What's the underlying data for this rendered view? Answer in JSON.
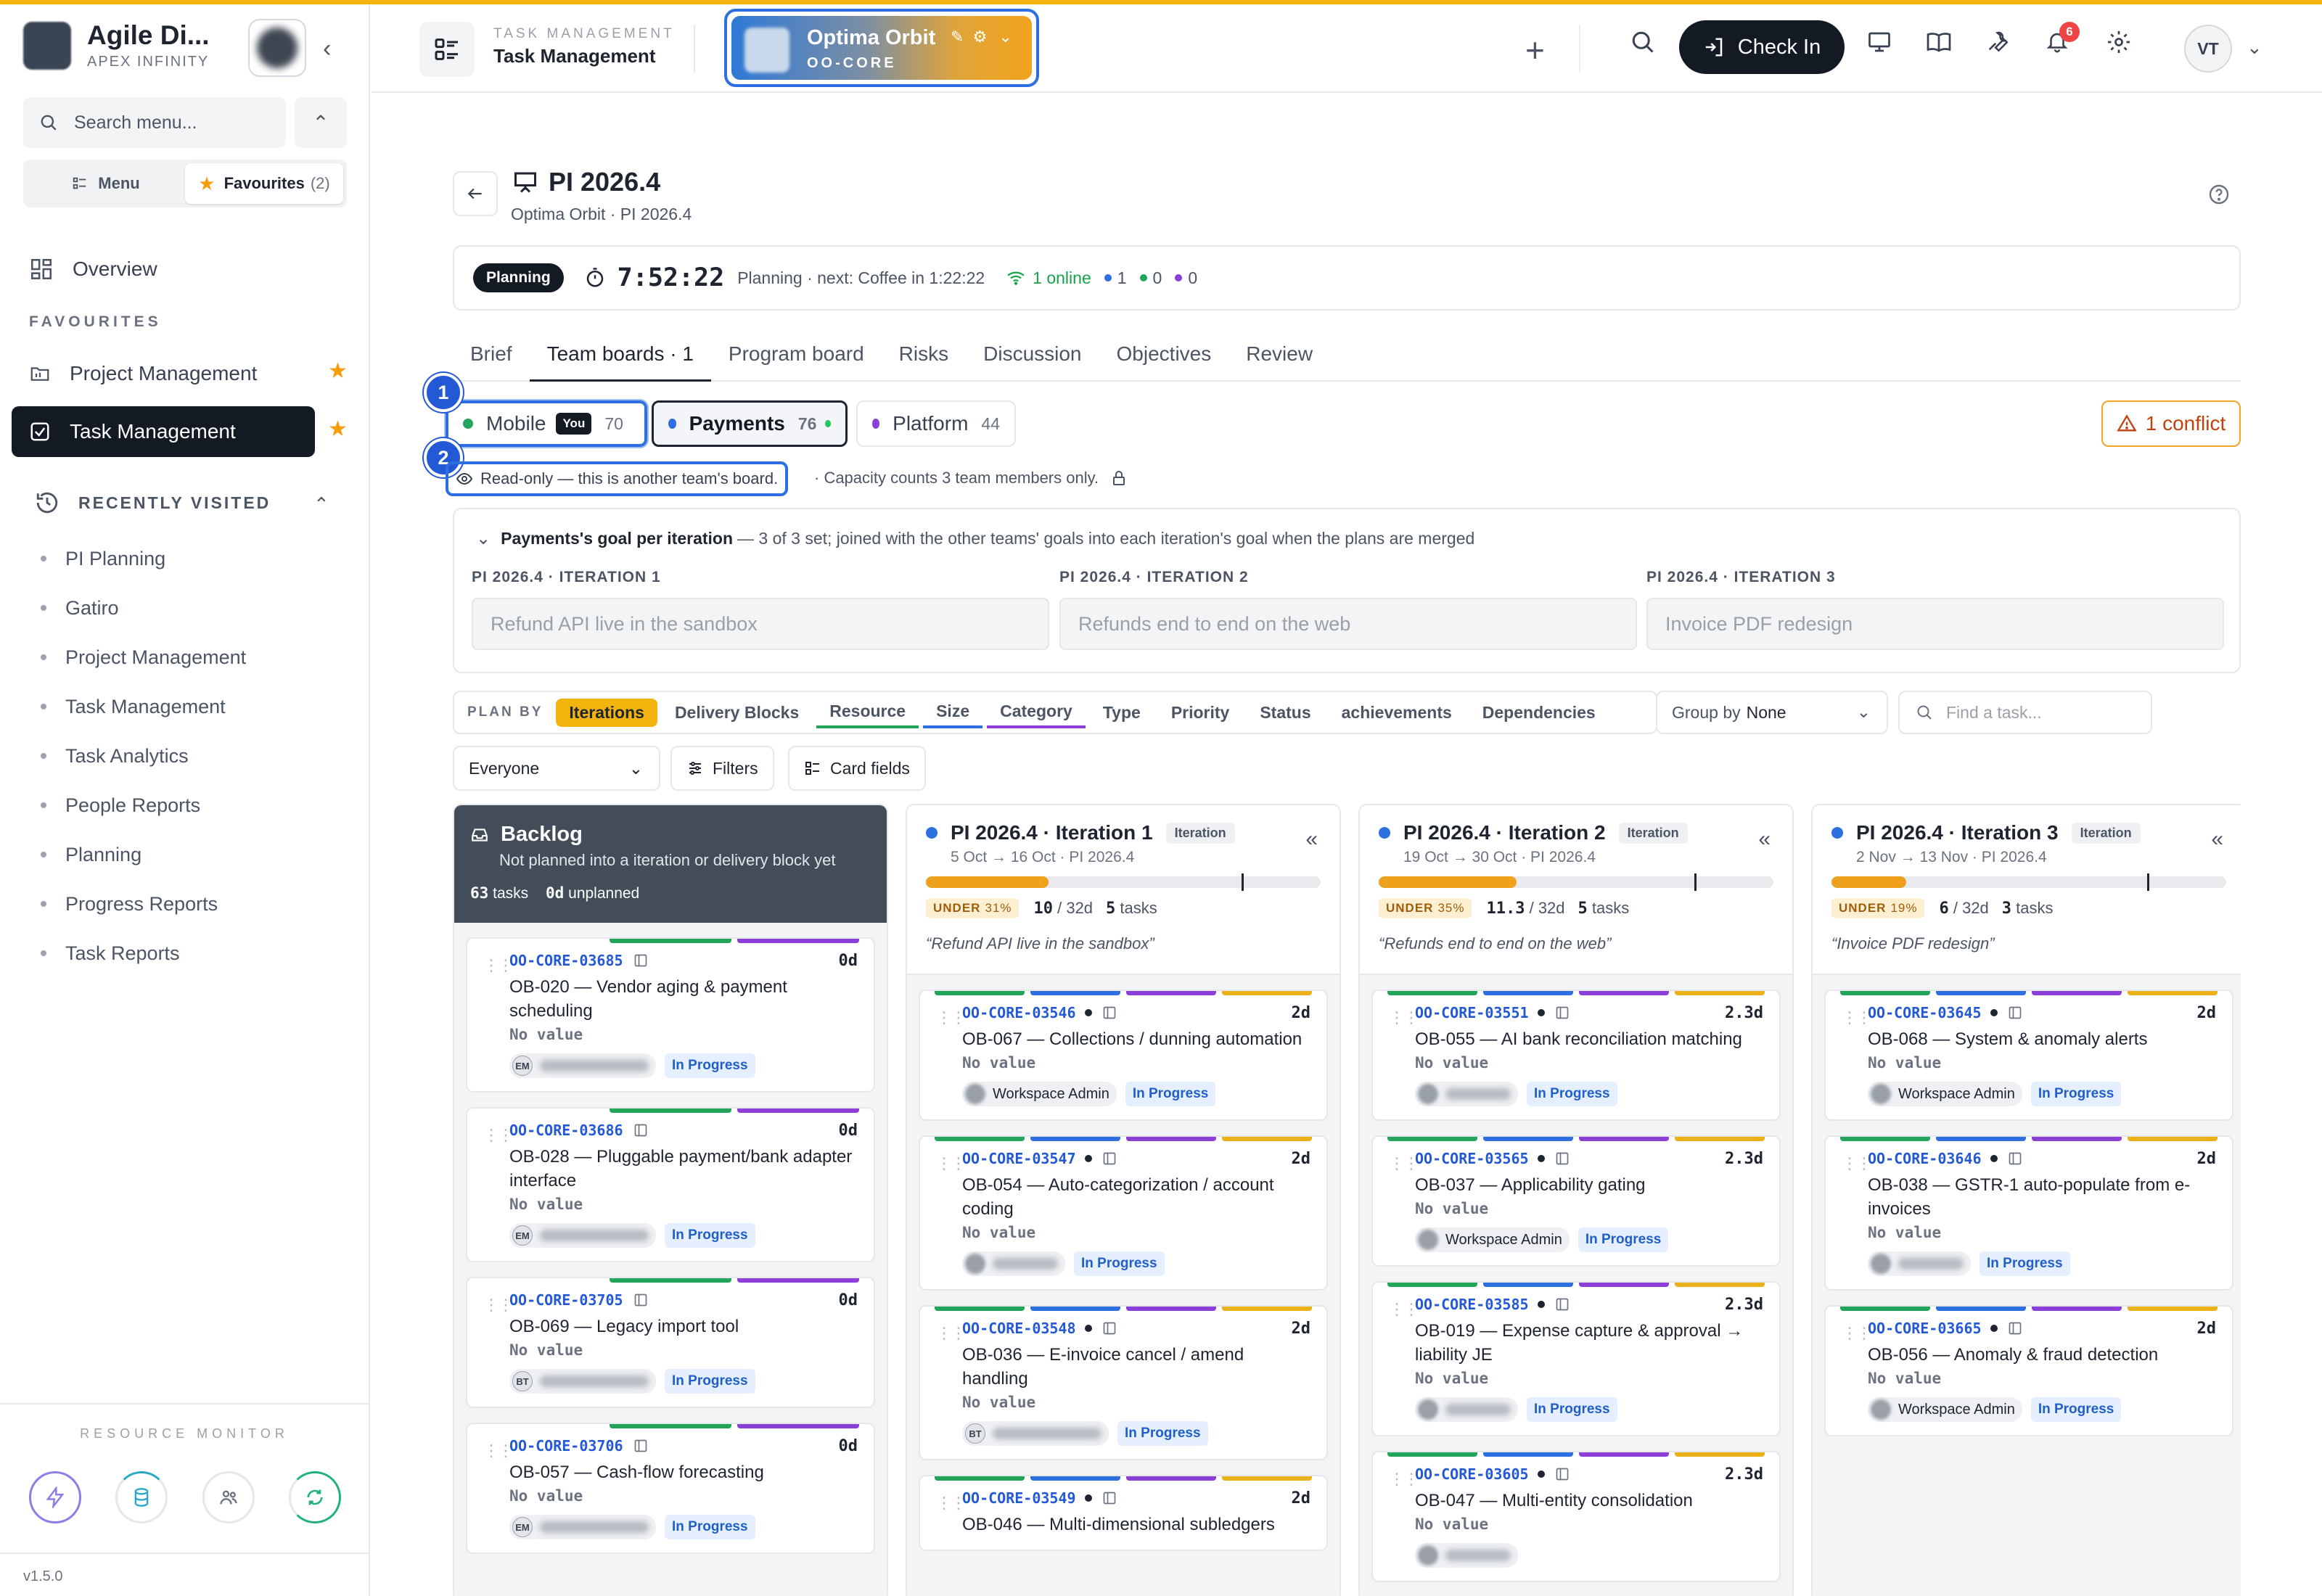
{
  "app": {
    "brand_name": "Agile Di...",
    "brand_sub": "APEX INFINITY",
    "version": "v1.5.0"
  },
  "sidebar": {
    "search_placeholder": "Search menu...",
    "seg_menu": "Menu",
    "seg_favourites": "Favourites",
    "seg_fav_count": "(2)",
    "overview": "Overview",
    "favourites_title": "FAVOURITES",
    "favourites": [
      {
        "label": "Project Management",
        "active": false
      },
      {
        "label": "Task Management",
        "active": true
      }
    ],
    "recent_title": "RECENTLY VISITED",
    "recent": [
      "PI Planning",
      "Gatiro",
      "Project Management",
      "Task Management",
      "Task Analytics",
      "People Reports",
      "Planning",
      "Progress Reports",
      "Task Reports"
    ],
    "resource_monitor": "RESOURCE MONITOR"
  },
  "header": {
    "crumb_top": "TASK MANAGEMENT",
    "crumb": "Task Management",
    "project_name": "Optima Orbit",
    "project_code": "OO-CORE",
    "checkin": "Check In",
    "notif_count": "6",
    "avatar": "VT"
  },
  "page": {
    "title": "PI 2026.4",
    "subtitle": "Optima Orbit · PI 2026.4"
  },
  "status": {
    "phase": "Planning",
    "timer": "7:52:22",
    "next": "Planning · next: Coffee in 1:22:22",
    "online": "1 online",
    "c_blue": "1",
    "c_green": "0",
    "c_purple": "0"
  },
  "tabs": [
    "Brief",
    "Team boards · 1",
    "Program board",
    "Risks",
    "Discussion",
    "Objectives",
    "Review"
  ],
  "teams": {
    "mobile": {
      "name": "Mobile",
      "you": "You",
      "count": "70"
    },
    "payments": {
      "name": "Payments",
      "count": "76"
    },
    "platform": {
      "name": "Platform",
      "count": "44"
    },
    "conflict": "1 conflict",
    "markers": [
      "1",
      "2"
    ]
  },
  "readonly": {
    "label": "Read-only — this is another team's board.",
    "note": "· Capacity counts 3 team members only."
  },
  "goals": {
    "title": "Payments's goal per iteration",
    "desc": "— 3 of 3 set; joined with the other teams' goals into each iteration's goal when the plans are merged",
    "items": [
      {
        "label": "PI 2026.4 · ITERATION 1",
        "value": "Refund API live in the sandbox"
      },
      {
        "label": "PI 2026.4 · ITERATION 2",
        "value": "Refunds end to end on the web"
      },
      {
        "label": "PI 2026.4 · ITERATION 3",
        "value": "Invoice PDF redesign"
      }
    ]
  },
  "planby": {
    "label": "PLAN BY",
    "items": [
      "Iterations",
      "Delivery Blocks",
      "Resource",
      "Size",
      "Category",
      "Type",
      "Priority",
      "Status",
      "achievements",
      "Dependencies"
    ],
    "group_by_label": "Group by",
    "group_by_value": "None",
    "find_placeholder": "Find a task..."
  },
  "filters": {
    "everyone": "Everyone",
    "filters": "Filters",
    "card_fields": "Card fields"
  },
  "backlog": {
    "title": "Backlog",
    "sub": "Not planned into a iteration or delivery block yet",
    "tasks": "63",
    "tasks_label": "tasks",
    "unplanned": "0d",
    "unplanned_label": "unplanned",
    "cards": [
      {
        "id": "OO-CORE-03685",
        "est": "0d",
        "title": "OB-020 — Vendor aging & payment scheduling",
        "nv": "No value",
        "initials": "EM",
        "status": "In Progress"
      },
      {
        "id": "OO-CORE-03686",
        "est": "0d",
        "title": "OB-028 — Pluggable payment/bank adapter interface",
        "nv": "No value",
        "initials": "EM",
        "status": "In Progress"
      },
      {
        "id": "OO-CORE-03705",
        "est": "0d",
        "title": "OB-069 — Legacy import tool",
        "nv": "No value",
        "initials": "BT",
        "status": "In Progress"
      },
      {
        "id": "OO-CORE-03706",
        "est": "0d",
        "title": "OB-057 — Cash-flow forecasting",
        "nv": "No value",
        "initials": "EM",
        "status": "In Progress"
      }
    ]
  },
  "iterations": [
    {
      "title": "PI 2026.4 · Iteration 1",
      "tag": "Iteration",
      "dates": "5 Oct → 16 Oct · PI 2026.4",
      "under": "UNDER",
      "pct": "31%",
      "fill": 0.31,
      "used": "10",
      "cap": "/ 32d",
      "tasks": "5",
      "tasks_label": "tasks",
      "goal": "“Refund API live in the sandbox”",
      "cards": [
        {
          "id": "OO-CORE-03546",
          "est": "2d",
          "title": "OB-067 — Collections / dunning automation",
          "nv": "No value",
          "assignee": "Workspace Admin",
          "status": "In Progress"
        },
        {
          "id": "OO-CORE-03547",
          "est": "2d",
          "title": "OB-054 — Auto-categorization / account coding",
          "nv": "No value",
          "assignee": "",
          "status": "In Progress"
        },
        {
          "id": "OO-CORE-03548",
          "est": "2d",
          "title": "OB-036 — E-invoice cancel / amend handling",
          "nv": "No value",
          "initials": "BT",
          "status": "In Progress"
        },
        {
          "id": "OO-CORE-03549",
          "est": "2d",
          "title": "OB-046 — Multi-dimensional subledgers",
          "nv": "",
          "assignee": "",
          "status": ""
        }
      ]
    },
    {
      "title": "PI 2026.4 · Iteration 2",
      "tag": "Iteration",
      "dates": "19 Oct → 30 Oct · PI 2026.4",
      "under": "UNDER",
      "pct": "35%",
      "fill": 0.35,
      "used": "11.3",
      "cap": "/ 32d",
      "tasks": "5",
      "tasks_label": "tasks",
      "goal": "“Refunds end to end on the web”",
      "cards": [
        {
          "id": "OO-CORE-03551",
          "est": "2.3d",
          "title": "OB-055 — AI bank reconciliation matching",
          "nv": "No value",
          "assignee": "",
          "status": "In Progress"
        },
        {
          "id": "OO-CORE-03565",
          "est": "2.3d",
          "title": "OB-037 — Applicability gating",
          "nv": "No value",
          "assignee": "Workspace Admin",
          "status": "In Progress"
        },
        {
          "id": "OO-CORE-03585",
          "est": "2.3d",
          "title": "OB-019 — Expense capture & approval → liability JE",
          "nv": "No value",
          "assignee": "",
          "status": "In Progress"
        },
        {
          "id": "OO-CORE-03605",
          "est": "2.3d",
          "title": "OB-047 — Multi-entity consolidation",
          "nv": "No value",
          "assignee": "",
          "status": ""
        }
      ]
    },
    {
      "title": "PI 2026.4 · Iteration 3",
      "tag": "Iteration",
      "dates": "2 Nov → 13 Nov · PI 2026.4",
      "under": "UNDER",
      "pct": "19%",
      "fill": 0.19,
      "used": "6",
      "cap": "/ 32d",
      "tasks": "3",
      "tasks_label": "tasks",
      "goal": "“Invoice PDF redesign”",
      "cards": [
        {
          "id": "OO-CORE-03645",
          "est": "2d",
          "title": "OB-068 — System & anomaly alerts",
          "nv": "No value",
          "assignee": "Workspace Admin",
          "status": "In Progress"
        },
        {
          "id": "OO-CORE-03646",
          "est": "2d",
          "title": "OB-038 — GSTR-1 auto-populate from e-invoices",
          "nv": "No value",
          "assignee": "",
          "status": "In Progress"
        },
        {
          "id": "OO-CORE-03665",
          "est": "2d",
          "title": "OB-056 — Anomaly & fraud detection",
          "nv": "No value",
          "assignee": "Workspace Admin",
          "status": "In Progress"
        }
      ]
    }
  ],
  "colors": {
    "accent": "#2d6fe0",
    "stripe_green": "#22a55a",
    "stripe_blue": "#2d6fe0",
    "stripe_purple": "#8b3fd6",
    "stripe_yellow": "#e9b21a",
    "team_mobile": "#22a55a",
    "team_payments": "#2d6fe0",
    "team_platform": "#8b3fd6"
  }
}
